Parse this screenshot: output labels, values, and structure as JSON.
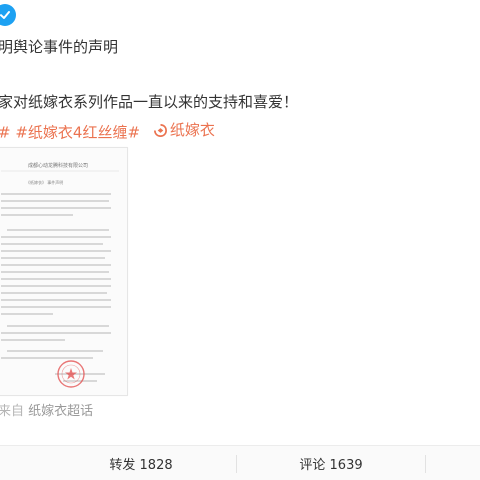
{
  "post": {
    "headline": "明舆论事件的声明",
    "body": "家对纸嫁衣系列作品一直以来的支持和喜爱！",
    "tags": [
      "#",
      "#纸嫁衣4红丝缠#"
    ],
    "super_topic": "纸嫁衣",
    "source_prefix": "来自",
    "source_name": "纸嫁衣超话"
  },
  "document": {
    "company": "成都心动龙腾科技有限公司",
    "subtitle": "《纸嫁衣》 事件声明"
  },
  "actions": {
    "repost_label": "转发 1828",
    "comment_label": "评论 1639"
  },
  "colors": {
    "tag": "#eb7350",
    "verified_badge": "#1da1f2",
    "seal": "#e34a4a"
  },
  "icons": {
    "verified": "verified-icon",
    "super_topic": "super-topic-icon"
  }
}
